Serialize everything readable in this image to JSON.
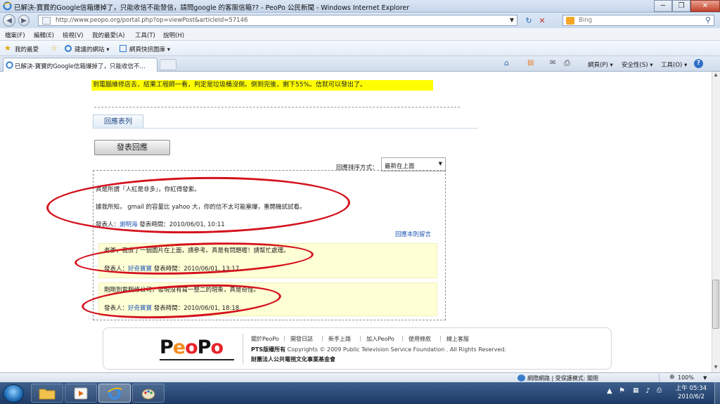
{
  "window": {
    "title": "已解決-寶寶的Google信箱爆掉了，只能收信不能發信，請問google 的客服信箱?? - PeoPo 公民新聞 - Windows Internet Explorer",
    "minimize_glyph": "─",
    "maximize_glyph": "❐",
    "close_glyph": "✕"
  },
  "address_bar": {
    "url": "http://www.peopo.org/portal.php?op=viewPost&articleId=57146",
    "back_glyph": "◀",
    "forward_glyph": "▶",
    "refresh_glyph": "↻",
    "stop_glyph": "✕"
  },
  "search": {
    "placeholder": "Bing",
    "button_glyph": "⚲"
  },
  "menu": [
    "檔案(F)",
    "編輯(E)",
    "檢視(V)",
    "我的最愛(A)",
    "工具(T)",
    "說明(H)"
  ],
  "favorites_bar": {
    "favorites_label": "我的最愛",
    "suggested_sites": "建議的網站 ▾",
    "web_slice_gallery": "網頁快訊圖庫 ▾"
  },
  "tab": {
    "title": "已解決-寶寶的Google信箱爆掉了，只能收信不..."
  },
  "command_bar": {
    "home_glyph": "⌂",
    "feeds_glyph": "▤",
    "mail_glyph": "✉",
    "print_glyph": "⎙",
    "page_menu": "網頁(P) ▾",
    "safety_menu": "安全性(S) ▾",
    "tools_menu": "工具(O) ▾",
    "help_glyph": "?"
  },
  "article": {
    "highlighted_text": "到電腦維修店去，結果工程師一看，判定是垃圾桶沒倒。倒到完後，剩下55%。信就可以發出了。"
  },
  "replies_section": {
    "tab_label": "回應表列",
    "post_button": "發表回應",
    "sort_label": "回應排序方式：",
    "sort_value": "最新在上面",
    "reply_link": "回應本則留言"
  },
  "comments": [
    {
      "lines": [
        "真是所謂『人紅是非多』，你紅得發紫。",
        "據我所知， gmail 的容量比 yahoo 大，你的信不太可能塞爆，重開機試試看。"
      ],
      "author_label": "發表人：",
      "author": "謝明海",
      "time_label": "發表時間：",
      "time": "2010/06/01, 10:11"
    },
    {
      "lines": [
        "老爹，我放了一個圖片在上面，請參考。真是有問題喔！請幫忙處理。"
      ],
      "author_label": "發表人：",
      "author": "好奇寶寶",
      "time_label": "發表時間：",
      "time": "2010/06/01, 13:17"
    },
    {
      "lines": [
        "剛剛到電腦修公司，發現沒有寫一整二的現象，真是奇怪。"
      ],
      "author_label": "發表人：",
      "author": "好奇寶寶",
      "time_label": "發表時間：",
      "time": "2010/06/01, 18:18"
    }
  ],
  "footer": {
    "logo_letters": [
      "P",
      "e",
      "o",
      "P",
      "o"
    ],
    "logo_colors": [
      "#111111",
      "#f28c1e",
      "#e7242a",
      "#111111",
      "#e7242a"
    ],
    "links": [
      "關於PeoPo",
      "開發日誌",
      "新手上路",
      "加入PeoPo",
      "使用條款",
      "線上客服"
    ],
    "copyright_brand": "PTS版權所有",
    "copyright_text": "Copyrights © 2009 Public Television Service Foundation . All Rights Reserved.",
    "organization": "財團法人公共電視文化事業基金會"
  },
  "status_bar": {
    "zone": "網際網路 | 受保護模式: 關閉",
    "zoom": "100%"
  },
  "taskbar": {
    "time": "上午 05:34",
    "date": "2010/6/2"
  },
  "colors": {
    "highlight": "#ffff00",
    "annotation_red": "#d4121d",
    "comment_bg": "#ffffd6",
    "link_blue": "#1e56b3"
  }
}
